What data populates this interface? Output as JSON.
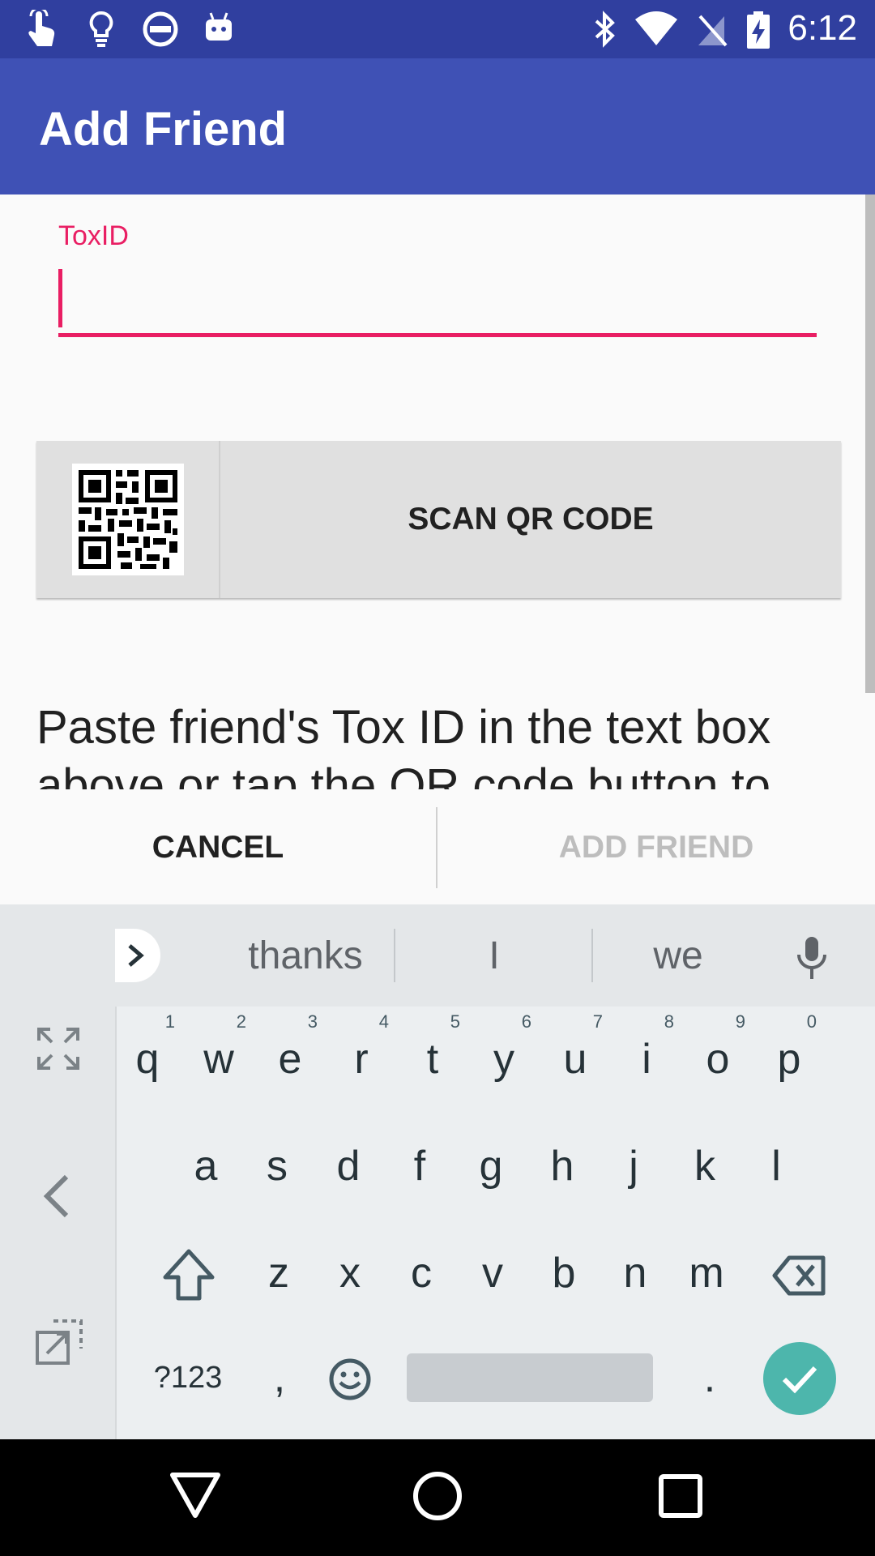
{
  "status_bar": {
    "time": "6:12",
    "left_icons": [
      "touch-hand-icon",
      "lightbulb-icon",
      "do-not-disturb-icon",
      "android-robot-icon"
    ],
    "right_icons": [
      "bluetooth-icon",
      "wifi-icon",
      "no-signal-icon",
      "battery-charging-icon"
    ]
  },
  "app_bar": {
    "title": "Add Friend"
  },
  "form": {
    "toxid_label": "ToxID",
    "toxid_value": ""
  },
  "scan_button": {
    "label": "SCAN QR CODE",
    "icon": "qr-code-icon"
  },
  "help_text": "Paste friend's Tox ID in the text box above or tap the QR code button to",
  "dialog_buttons": {
    "cancel": "CANCEL",
    "add_friend": "ADD FRIEND"
  },
  "keyboard": {
    "suggestions": [
      "thanks",
      "I",
      "we"
    ],
    "row1": [
      {
        "k": "q",
        "h": "1"
      },
      {
        "k": "w",
        "h": "2"
      },
      {
        "k": "e",
        "h": "3"
      },
      {
        "k": "r",
        "h": "4"
      },
      {
        "k": "t",
        "h": "5"
      },
      {
        "k": "y",
        "h": "6"
      },
      {
        "k": "u",
        "h": "7"
      },
      {
        "k": "i",
        "h": "8"
      },
      {
        "k": "o",
        "h": "9"
      },
      {
        "k": "p",
        "h": "0"
      }
    ],
    "row2": [
      "a",
      "s",
      "d",
      "f",
      "g",
      "h",
      "j",
      "k",
      "l"
    ],
    "row3": [
      "z",
      "x",
      "c",
      "v",
      "b",
      "n",
      "m"
    ],
    "symbols_key": "?123",
    "comma_key": ",",
    "period_key": ".",
    "colors": {
      "enter": "#4db6ac"
    }
  },
  "colors": {
    "status_bar": "#303f9f",
    "app_bar": "#3f51b5",
    "accent": "#e91e63"
  }
}
